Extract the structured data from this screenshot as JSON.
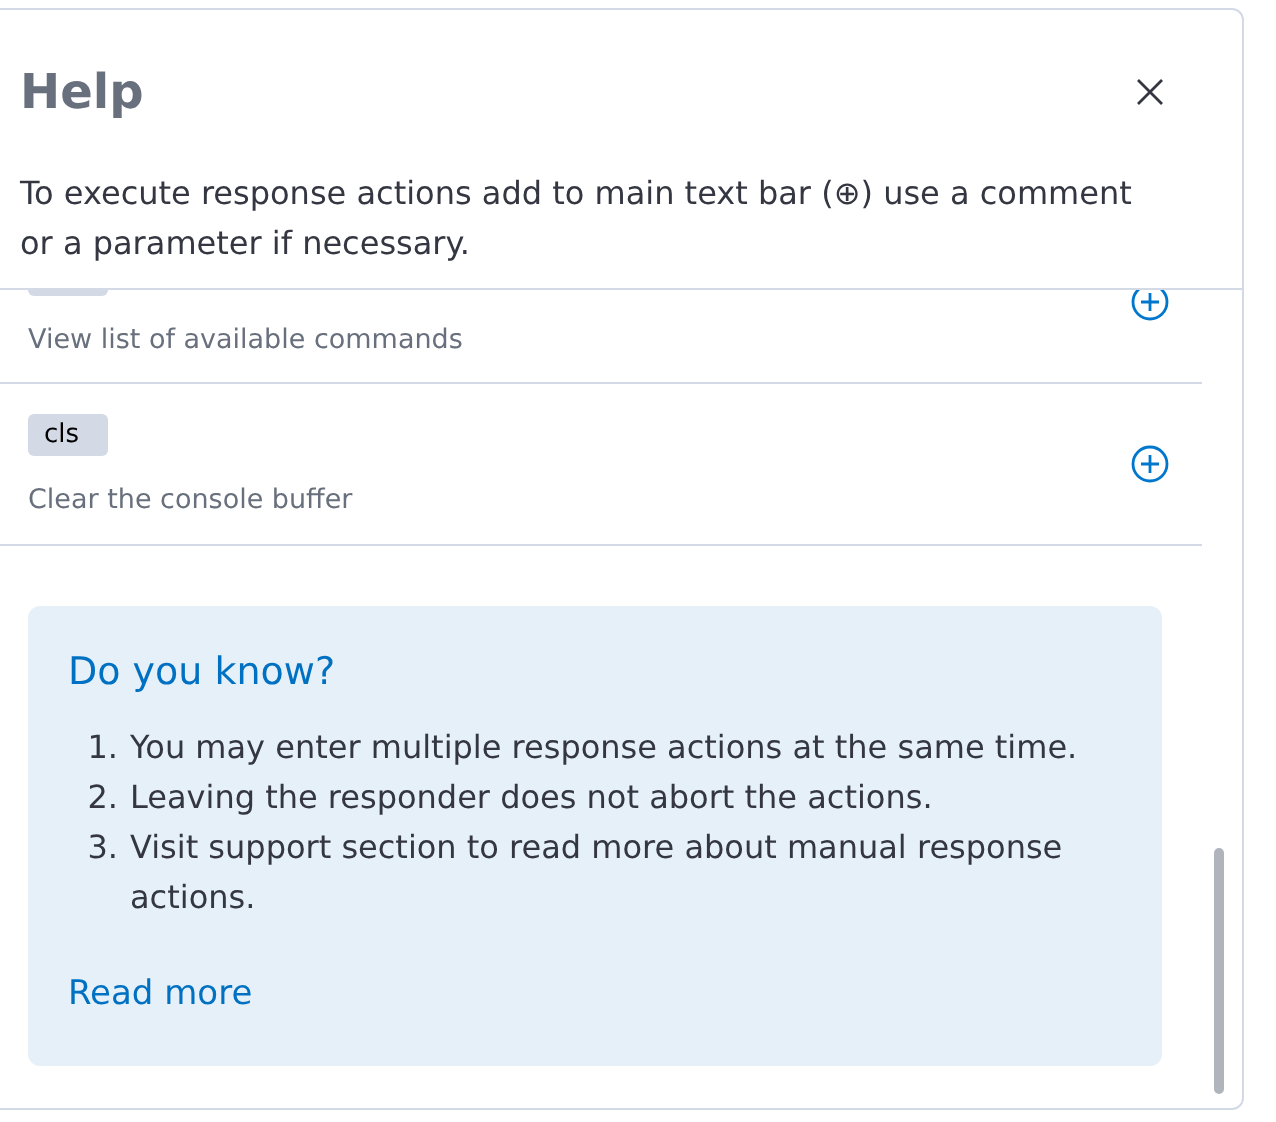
{
  "panel": {
    "title": "Help",
    "intro": "To execute response actions add to main text bar (⊕) use a comment or a parameter if necessary."
  },
  "commands": [
    {
      "badge_partial": true,
      "description": "View list of available commands"
    },
    {
      "badge": "cls",
      "description": "Clear the console buffer"
    }
  ],
  "callout": {
    "title": "Do you know?",
    "items": [
      {
        "number": "1.",
        "text": "You may enter multiple response actions at the same time."
      },
      {
        "number": "2.",
        "text": "Leaving the responder does not abort the actions."
      },
      {
        "number": "3.",
        "text": "Visit support section to read more about manual response actions."
      }
    ],
    "link": "Read more"
  }
}
